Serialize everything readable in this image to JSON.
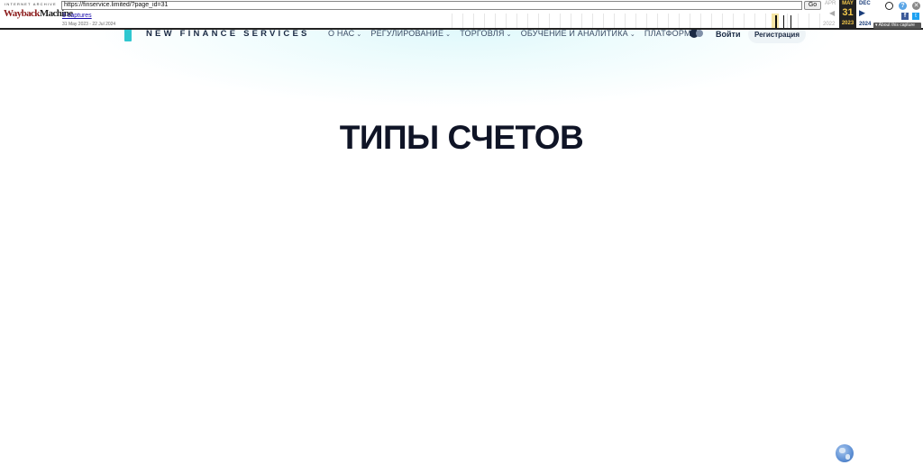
{
  "site": {
    "brand": "NEW FINANCE SERVICES",
    "nav": [
      {
        "label": "О НАС",
        "has_dropdown": true
      },
      {
        "label": "РЕГУЛИРОВАНИЕ",
        "has_dropdown": true
      },
      {
        "label": "ТОРГОВЛЯ",
        "has_dropdown": true
      },
      {
        "label": "ОБУЧЕНИЕ И АНАЛИТИКА",
        "has_dropdown": true
      },
      {
        "label": "ПЛАТФОРМА",
        "has_dropdown": false
      }
    ],
    "chevron": "⌄",
    "login_label": "Войти",
    "register_label": "Регистрация",
    "accent_color": "#2fc7d0",
    "text_color": "#1b2a44"
  },
  "main": {
    "title": "ТИПЫ СЧЕТОВ"
  },
  "wayback": {
    "logo_top": "INTERNET ARCHIVE",
    "logo_main_a": "Wayback",
    "logo_main_b": "Machine",
    "url": "https://finservice.limited/?page_id=31",
    "go_label": "Go",
    "captures_label": "3 captures",
    "date_range": "31 May 2023 - 22 Jul 2024",
    "prev_month": "APR",
    "prev_year": "2022",
    "current_month": "MAY",
    "current_day": "31",
    "current_year": "2023",
    "next_month": "DEC",
    "next_year": "2024",
    "about_label": "▾ About this capture",
    "prev_arrow": "◀",
    "next_arrow": "▶",
    "help_glyph": "?",
    "close_glyph": "✕",
    "facebook_glyph": "f",
    "twitter_glyph": "t"
  }
}
